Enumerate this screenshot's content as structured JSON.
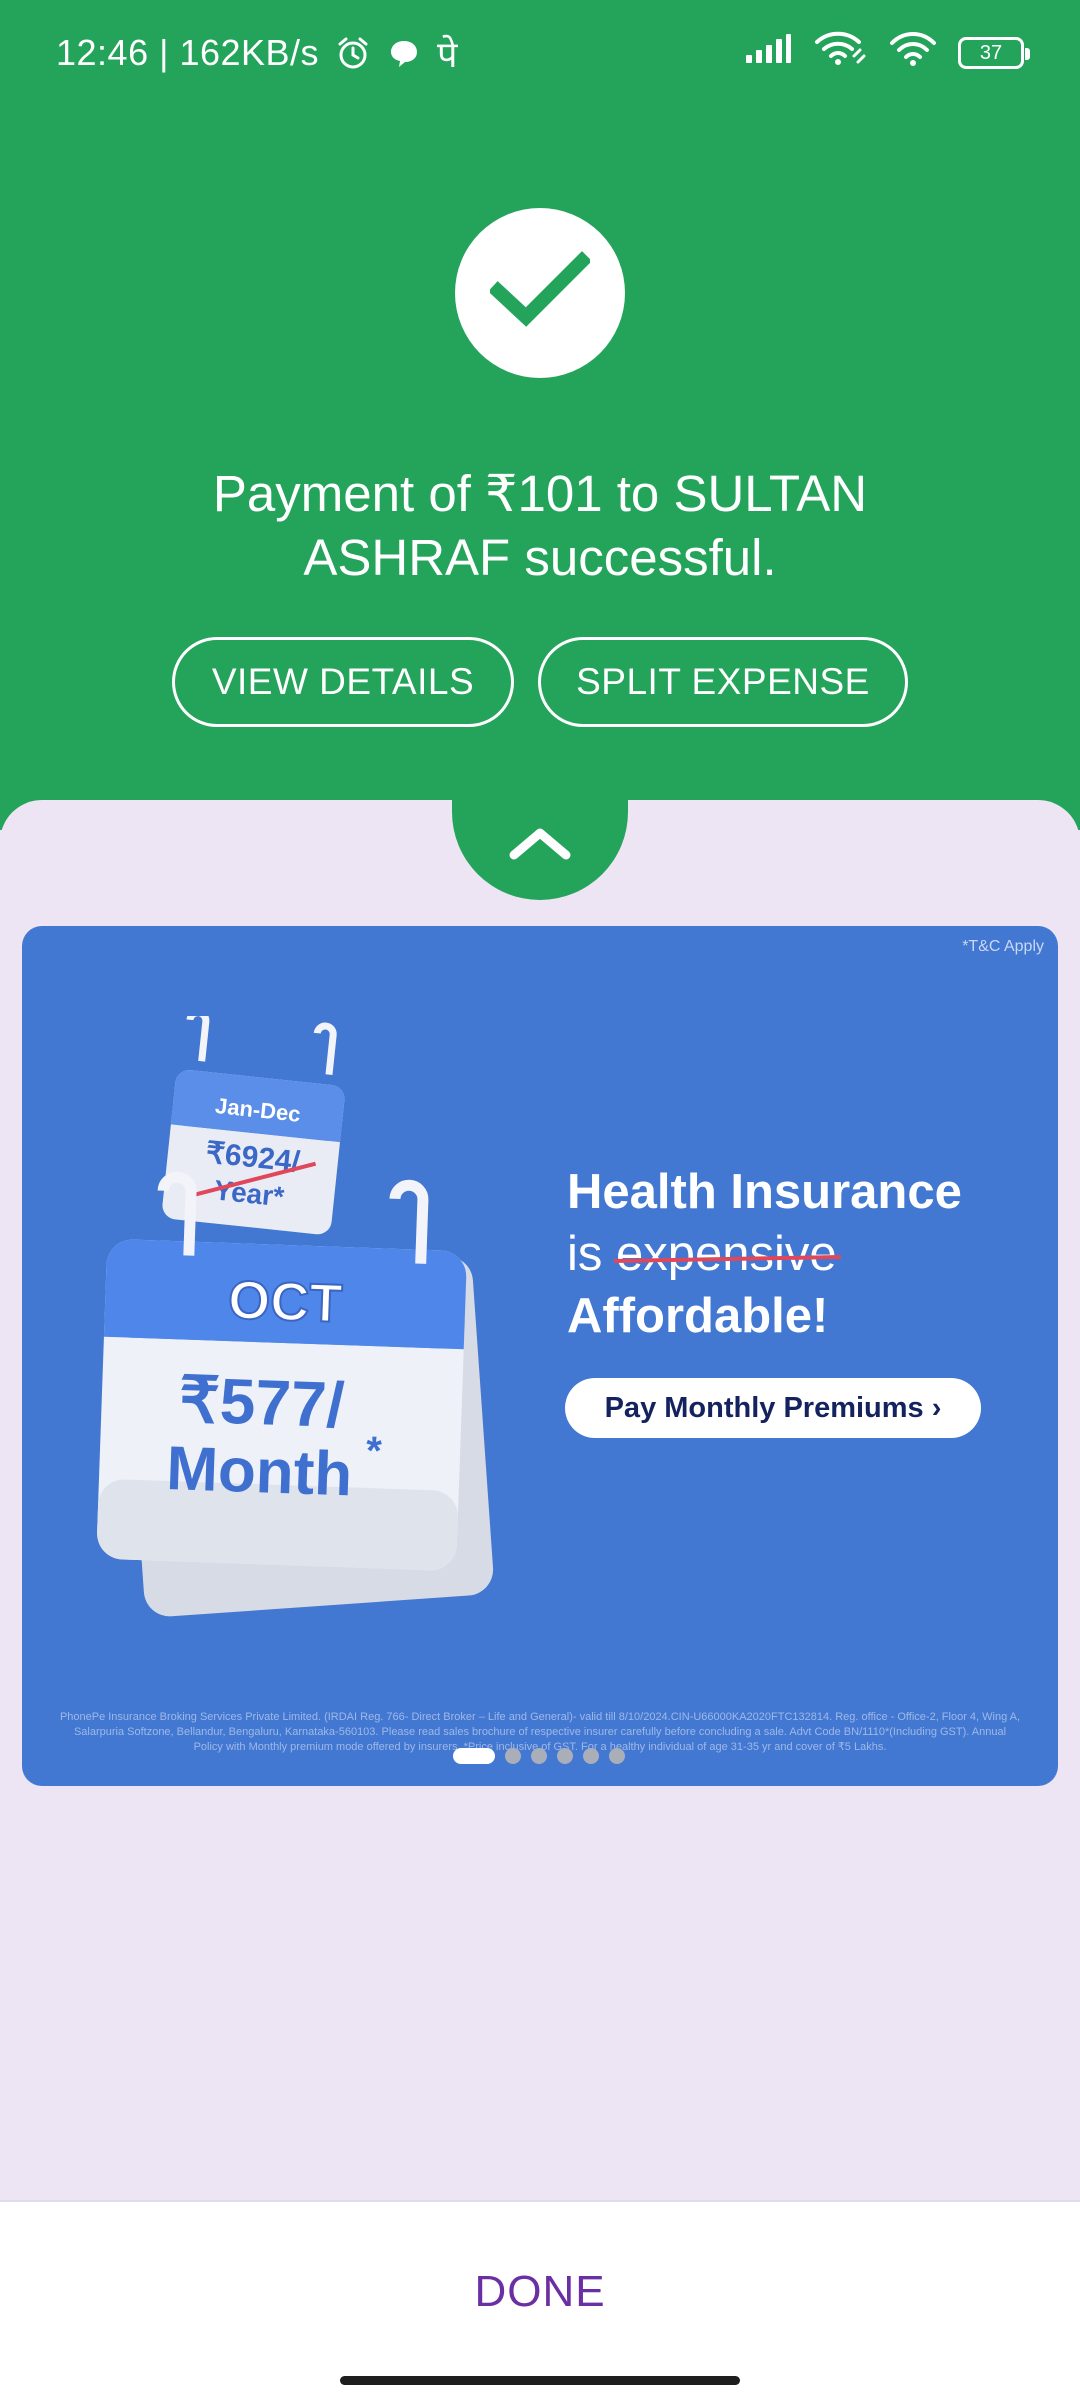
{
  "status_bar": {
    "time_speed": "12:46 | 162KB/s",
    "extra_glyph": "पे",
    "battery": "37"
  },
  "payment": {
    "message": "Payment of ₹101 to SULTAN ASHRAF successful.",
    "view_details_label": "VIEW DETAILS",
    "split_expense_label": "SPLIT EXPENSE"
  },
  "banner": {
    "tc": "*T&C Apply",
    "small_cal_month": "Jan-Dec",
    "small_cal_price": "₹6924/",
    "small_cal_unit": "Year*",
    "big_cal_month": "OCT",
    "big_cal_price": "₹577/",
    "big_cal_unit": "Month",
    "big_cal_asterisk": "*",
    "headline_line1": "Health Insurance",
    "headline_is": "is",
    "headline_struck": "expensive",
    "headline_line3": "Affordable!",
    "cta_label": "Pay Monthly Premiums ›",
    "disclaimer": "PhonePe Insurance Broking Services Private Limited. (IRDAI Reg. 766- Direct Broker – Life and General)- valid till 8/10/2024.CIN-U66000KA2020FTC132814. Reg. office - Office-2, Floor 4, Wing A, Salarpuria Softzone, Bellandur, Bengaluru, Karnataka-560103. Please read sales brochure of respective insurer carefully before concluding a sale. Advt Code BN/1110*(Including GST). Annual Policy with Monthly premium mode offered by insurers. *Price inclusive of GST. For a healthy individual of age 31-35 yr and cover of ₹5 Lakhs.",
    "slides": 6,
    "active_slide": 1
  },
  "footer": {
    "done_label": "DONE"
  },
  "colors": {
    "success_green": "#24a35a",
    "sheet_bg": "#ede4f4",
    "banner_blue": "#4278d1",
    "done_purple": "#6a2fa2"
  }
}
